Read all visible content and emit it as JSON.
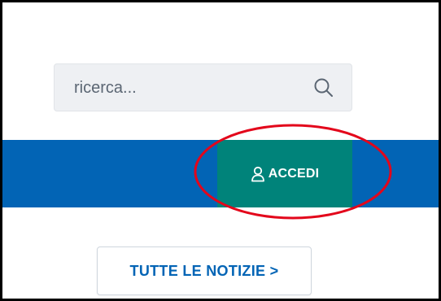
{
  "search": {
    "placeholder": "ricerca...",
    "icon": "search-icon"
  },
  "nav": {
    "bar_color": "#0264b5",
    "login": {
      "label": "ACCEDI",
      "icon": "user-icon",
      "color": "#00837a"
    }
  },
  "annotation": {
    "shape": "ellipse",
    "color": "#e3061b"
  },
  "news": {
    "all_news_label": "TUTTE LE NOTIZIE >"
  }
}
